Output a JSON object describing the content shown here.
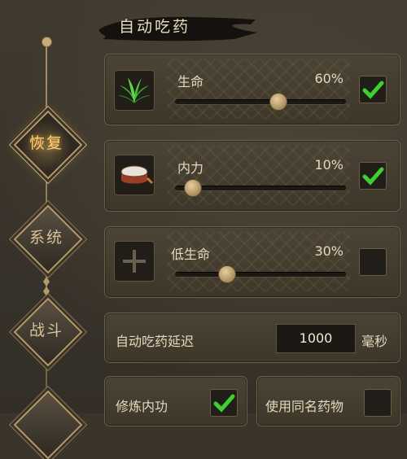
{
  "header": {
    "title": "自动吃药"
  },
  "nav": [
    {
      "label": "恢复",
      "active": true
    },
    {
      "label": "系统",
      "active": false
    },
    {
      "label": "战斗",
      "active": false
    }
  ],
  "potions": [
    {
      "label": "生命",
      "percent_text": "60%",
      "value": 0.6,
      "checked": true,
      "icon": "herb-icon"
    },
    {
      "label": "内力",
      "percent_text": "10%",
      "value": 0.1,
      "checked": true,
      "icon": "drum-icon"
    },
    {
      "label": "低生命",
      "percent_text": "30%",
      "value": 0.3,
      "checked": false,
      "icon": "plus-icon"
    }
  ],
  "delay": {
    "label": "自动吃药延迟",
    "value": "1000",
    "unit": "毫秒"
  },
  "options": [
    {
      "label": "修炼内功",
      "checked": true
    },
    {
      "label": "使用同名药物",
      "checked": false
    }
  ],
  "colors": {
    "check": "#3bd22f",
    "accent": "#ffd27a"
  }
}
